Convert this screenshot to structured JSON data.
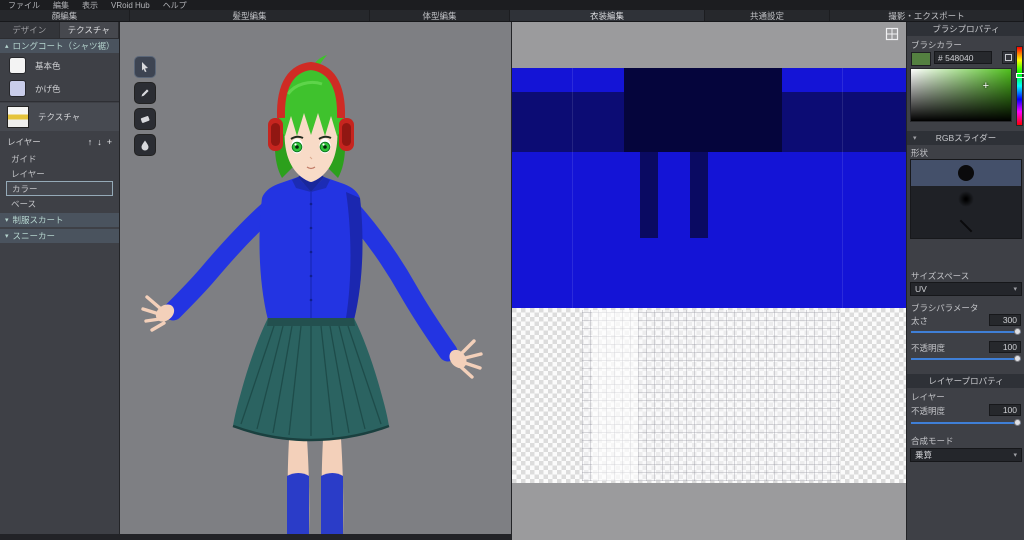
{
  "colors": {
    "accent_blue": "#3f7fd6",
    "brush_color": "#548040",
    "texture_blue": "#1414d6"
  },
  "icons": {
    "collapse": "▴",
    "expand": "▾",
    "dropdown": "▾",
    "up": "↑",
    "down": "↓",
    "add": "+",
    "crosshair": "+"
  },
  "menubar": {
    "items": [
      "ファイル",
      "編集",
      "表示",
      "VRoid Hub",
      "ヘルプ"
    ]
  },
  "mode_tabs": {
    "items": [
      "顔編集",
      "髪型編集",
      "体型編集",
      "衣装編集",
      "共通設定",
      "撮影・エクスポート"
    ],
    "active": "衣装編集"
  },
  "sidebar": {
    "tabs": [
      "デザイン",
      "テクスチャ"
    ],
    "active_tab": "テクスチャ",
    "section_title": "ロングコート（シャツ裾）",
    "color_items": [
      {
        "label": "基本色"
      },
      {
        "label": "かげ色"
      }
    ],
    "texture_item_label": "テクスチャ",
    "layers_header": "レイヤー",
    "layer_actions": [
      "↑",
      "↓",
      "+"
    ],
    "layer_items": [
      "ガイド",
      "レイヤー",
      "カラー",
      "ベース"
    ],
    "selected_layer": "カラー",
    "collapsed_sections": [
      "制服スカート",
      "スニーカー"
    ]
  },
  "brush_panel": {
    "title": "ブラシプロパティ",
    "brush_color_label": "ブラシカラー",
    "color_hex": "# 548040",
    "rgb_section": "RGBスライダー",
    "shape_label": "形状",
    "size_space_label": "サイズスペース",
    "size_space_value": "UV",
    "params_label": "ブラシパラメータ",
    "thickness_label": "太さ",
    "thickness_value": "300",
    "opacity_label": "不透明度",
    "opacity_value": "100"
  },
  "layer_panel": {
    "title": "レイヤープロパティ",
    "layer_label": "レイヤー",
    "opacity_label": "不透明度",
    "opacity_value": "100",
    "blend_label": "合成モード",
    "blend_value": "乗算"
  }
}
